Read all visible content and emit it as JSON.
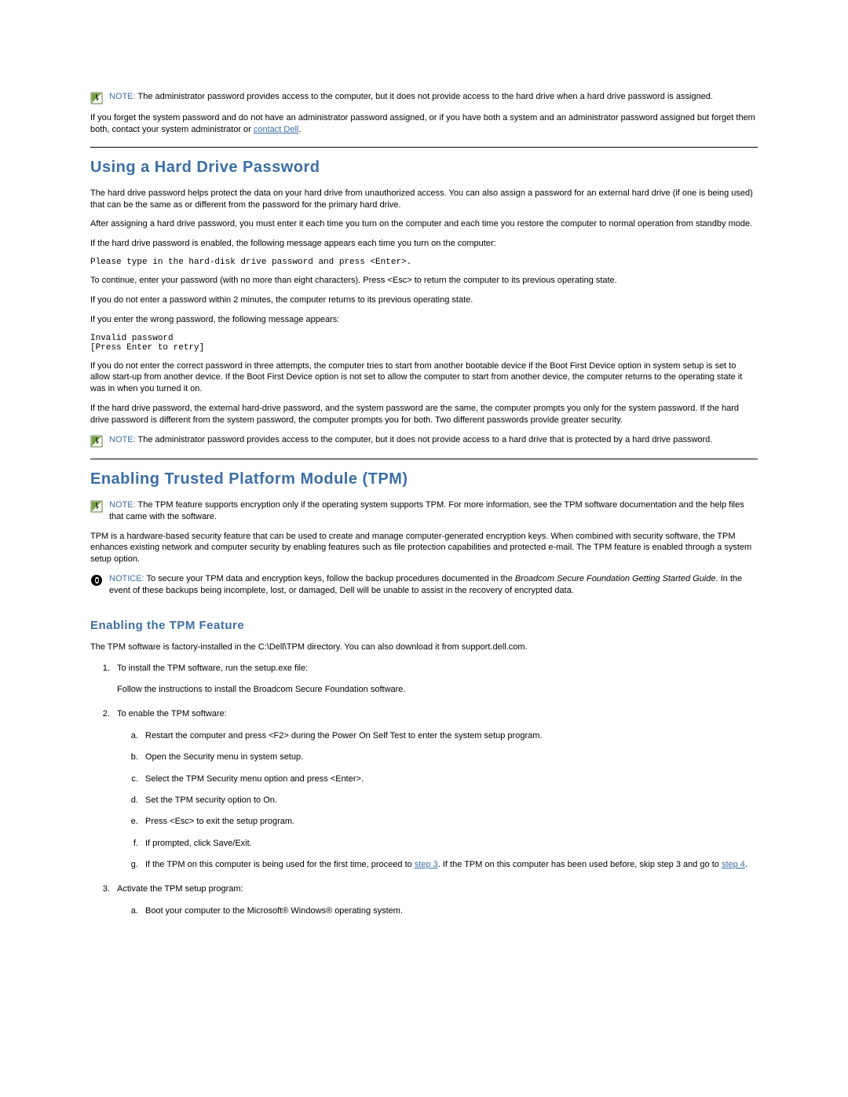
{
  "note1": {
    "label": "NOTE:",
    "text": " The administrator password provides access to the computer, but it does not provide access to the hard drive when a hard drive password is assigned."
  },
  "para_forget_pre": "If you forget the system password and do not have an administrator password assigned, or if you have both a system and an administrator password assigned but forget them both, contact your system administrator or ",
  "link_contact": "contact Dell",
  "para_forget_post": ".",
  "sec1_title": "Using a Hard Drive Password",
  "sec1": {
    "p1": "The hard drive password helps protect the data on your hard drive from unauthorized access. You can also assign a password for an external hard drive (if one is being used) that can be the same as or different from the password for the primary hard drive.",
    "p2": "After assigning a hard drive password, you must enter it each time you turn on the computer and each time you restore the computer to normal operation from standby mode.",
    "p3": "If the hard drive password is enabled, the following message appears each time you turn on the computer:",
    "code1": "Please type in the hard-disk drive password and press <Enter>.",
    "p4": "To continue, enter your password (with no more than eight characters). Press <Esc> to return the computer to its previous operating state.",
    "p5": "If you do not enter a password within 2 minutes, the computer returns to its previous operating state.",
    "p6": "If you enter the wrong password, the following message appears:",
    "code2": "Invalid password\n[Press Enter to retry]",
    "p7": "If you do not enter the correct password in three attempts, the computer tries to start from another bootable device if the Boot First Device option in system setup is set to allow start-up from another device. If the Boot First Device option is not set to allow the computer to start from another device, the computer returns to the operating state it was in when you turned it on.",
    "p8": "If the hard drive password, the external hard-drive password, and the system password are the same, the computer prompts you only for the system password. If the hard drive password is different from the system password, the computer prompts you for both. Two different passwords provide greater security."
  },
  "note2": {
    "label": "NOTE:",
    "text": " The administrator password provides access to the computer, but it does not provide access to a hard drive that is protected by a hard drive password."
  },
  "sec2_title": "Enabling Trusted Platform Module (TPM)",
  "note3": {
    "label": "NOTE:",
    "text": " The TPM feature supports encryption only if the operating system supports TPM. For more information, see the TPM software documentation and the help files that came with the software."
  },
  "sec2_p1": "TPM is a hardware-based security feature that can be used to create and manage computer-generated encryption keys. When combined with security software, the TPM enhances existing network and computer security by enabling features such as file protection capabilities and protected e-mail. The TPM feature is enabled through a system setup option.",
  "notice1": {
    "label": "NOTICE:",
    "pre": " To secure your TPM data and encryption keys, follow the backup procedures documented in the ",
    "em": "Broadcom Secure Foundation Getting Started Guide",
    "post": ". In the event of these backups being incomplete, lost, or damaged, Dell will be unable to assist in the recovery of encrypted data."
  },
  "sub1_title": "Enabling the TPM Feature",
  "sub1_p1": "The TPM software is factory-installed in the C:\\Dell\\TPM directory. You can also download it from support.dell.com.",
  "list": {
    "i1": "To install the TPM software, run the setup.exe file:",
    "i1_extra": "Follow the instructions to install the Broadcom Secure Foundation software.",
    "i2": "To enable the TPM software:",
    "i2_sub": {
      "a": "Restart the computer and press <F2> during the Power On Self Test to enter the system setup program.",
      "b": "Open the Security menu in system setup.",
      "c": "Select the TPM Security menu option and press <Enter>.",
      "d": "Set the TPM security option to On.",
      "e": "Press <Esc> to exit the setup program.",
      "f": "If prompted, click Save/Exit.",
      "g_pre": "If the TPM on this computer is being used for the first time, proceed to ",
      "g_link1": "step 3",
      "g_mid": ". If the TPM on this computer has been used before, skip step 3 and go to ",
      "g_link2": "step 4",
      "g_post": "."
    },
    "i3": "Activate the TPM setup program:",
    "i3_sub": {
      "a": "Boot your computer to the Microsoft® Windows® operating system."
    }
  }
}
